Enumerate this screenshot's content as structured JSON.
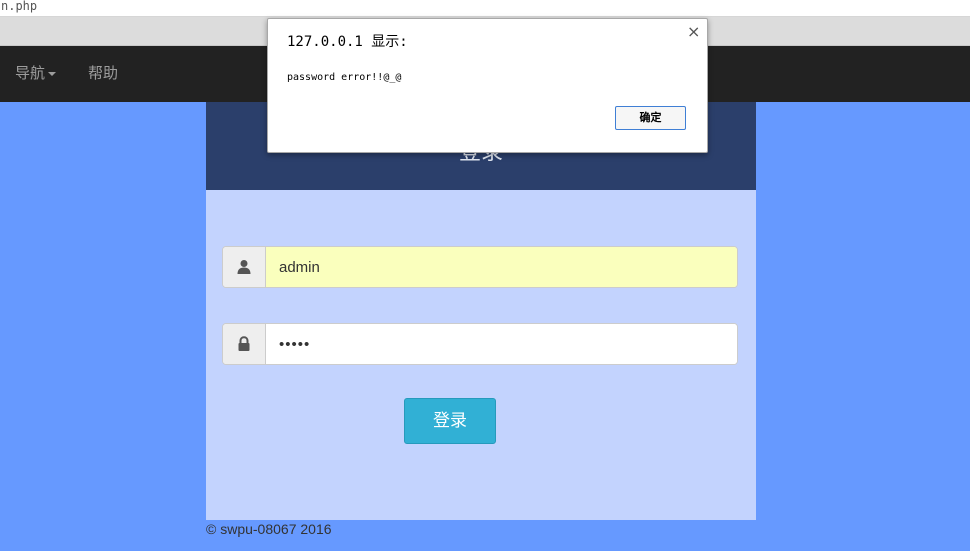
{
  "browser": {
    "url_fragment": "n.php"
  },
  "navbar": {
    "items": [
      {
        "label": "导航",
        "has_dropdown": true
      },
      {
        "label": "帮助",
        "has_dropdown": false
      }
    ]
  },
  "panel": {
    "title": "登录"
  },
  "form": {
    "username": {
      "value": "admin",
      "icon": "user-icon"
    },
    "password": {
      "value": "•••••",
      "icon": "lock-icon"
    },
    "submit_label": "登录"
  },
  "footer": {
    "text": "© swpu-08067 2016"
  },
  "alert": {
    "title": "127.0.0.1 显示:",
    "message": "password error!!@_@",
    "ok_label": "确定",
    "close_glyph": "×"
  },
  "colors": {
    "page_bg": "#6699ff",
    "navbar_bg": "#222222",
    "panel_header_bg": "#2b3f6b",
    "panel_body_bg": "#c3d3fe",
    "button_bg": "#31b0d5",
    "autofill_bg": "#faffbd"
  }
}
